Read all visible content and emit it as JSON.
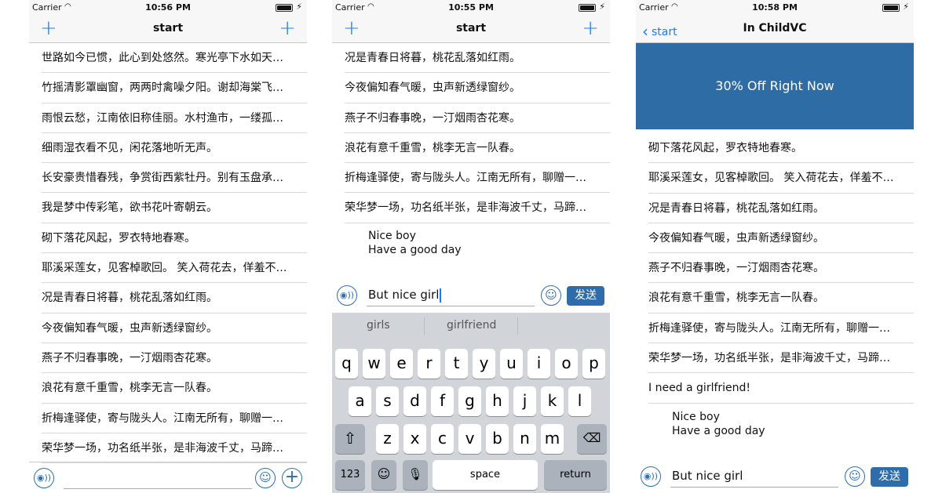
{
  "status": {
    "carrier": "Carrier",
    "times": [
      "10:56 PM",
      "10:55 PM",
      "10:58 PM"
    ]
  },
  "screen1": {
    "title": "start",
    "left_button": "+",
    "right_button": "+",
    "rows": [
      "世路如今已惯，此心到处悠然。寒光亭下水如天，飞起沙鸥一片。",
      "竹摇清影罩幽窗，两两时禽噪夕阳。谢却海棠飞尽絮，困人天气日初长。",
      "雨恨云愁，江南依旧称佳丽。水村渔市，一缕孤烟细。",
      "细雨湿衣看不见，闲花落地听无声。",
      "长安豪贵惜春残，争赏街西紫牡丹。别有玉盘承露冷，无人起就月中看。",
      "我是梦中传彩笔，欲书花叶寄朝云。",
      "砌下落花风起，罗衣特地春寒。",
      "耶溪采莲女，见客棹歌回。 笑入荷花去，佯羞不出来。",
      "况是青春日将暮，桃花乱落如红雨。",
      "今夜偏知春气暖，虫声新透绿窗纱。",
      "燕子不归春事晚，一汀烟雨杏花寒。",
      "浪花有意千重雪，桃李无言一队春。",
      "折梅逢驿使，寄与陇头人。江南无所有，聊赠一枝春。",
      "荣华梦一场，功名纸半张，是非海波千丈，马蹄踏碎禁街霜。"
    ],
    "input_value": ""
  },
  "screen2": {
    "title": "start",
    "left_button": "+",
    "right_button": "+",
    "rows": [
      "况是青春日将暮，桃花乱落如红雨。",
      "今夜偏知春气暖，虫声新透绿窗纱。",
      "燕子不归春事晚，一汀烟雨杏花寒。",
      "浪花有意千重雪，桃李无言一队春。",
      "折梅逢驿使，寄与陇头人。江南无所有，聊赠一枝春。",
      "荣华梦一场，功名纸半张，是非海波千丈，马蹄踏碎禁街霜。"
    ],
    "bubble_line1": "Nice boy",
    "bubble_line2": "Have a good day",
    "input_value": "But nice girl",
    "send_label": "发送",
    "suggestions": [
      "girls",
      "girlfriend",
      ""
    ],
    "keys_row1": [
      "q",
      "w",
      "e",
      "r",
      "t",
      "y",
      "u",
      "i",
      "o",
      "p"
    ],
    "keys_row2": [
      "a",
      "s",
      "d",
      "f",
      "g",
      "h",
      "j",
      "k",
      "l"
    ],
    "keys_row3": [
      "z",
      "x",
      "c",
      "v",
      "b",
      "n",
      "m"
    ],
    "key_123": "123",
    "key_space": "space",
    "key_return": "return"
  },
  "screen3": {
    "title": "In ChildVC",
    "back_label": "start",
    "banner": "30% Off Right Now",
    "rows": [
      "砌下落花风起，罗衣特地春寒。",
      "耶溪采莲女，见客棹歌回。 笑入荷花去，佯羞不出来。",
      "况是青春日将暮，桃花乱落如红雨。",
      "今夜偏知春气暖，虫声新透绿窗纱。",
      "燕子不归春事晚，一汀烟雨杏花寒。",
      "浪花有意千重雪，桃李无言一队春。",
      "折梅逢驿使，寄与陇头人。江南无所有，聊赠一枝春。",
      "荣华梦一场，功名纸半张，是非海波千丈，马蹄踏碎禁街霜。",
      "I need a girlfriend!"
    ],
    "bubble_line1": "Nice boy",
    "bubble_line2": "Have a good day",
    "input_value": "But nice girl",
    "send_label": "发送"
  },
  "colors": {
    "accent": "#1a7cf5",
    "send": "#2e6da9",
    "banner": "#2e6ca5"
  }
}
